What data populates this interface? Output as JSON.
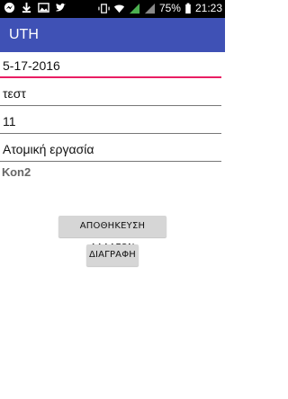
{
  "status_bar": {
    "battery_percent": "75%",
    "time": "21:23",
    "left_icons": [
      "messenger-icon",
      "download-icon",
      "image-icon",
      "twitter-icon"
    ],
    "right_icons": [
      "vibrate-icon",
      "wifi-icon",
      "signal-icon",
      "signal-icon",
      "battery-icon"
    ]
  },
  "app_bar": {
    "title": "UTH"
  },
  "form": {
    "date": "5-17-2016",
    "name": "τεστ",
    "number": "11",
    "type": "Ατομική εργασία",
    "code": "Κοn2"
  },
  "buttons": {
    "save_label": "ΑΠΟΘΗΚΕΥΣΗ ΑΛΛΑΓΩΝ",
    "delete_label": "ΔΙΑΓΡΑΦΗ"
  },
  "colors": {
    "primary": "#3f51b5",
    "accent": "#e91e63"
  }
}
